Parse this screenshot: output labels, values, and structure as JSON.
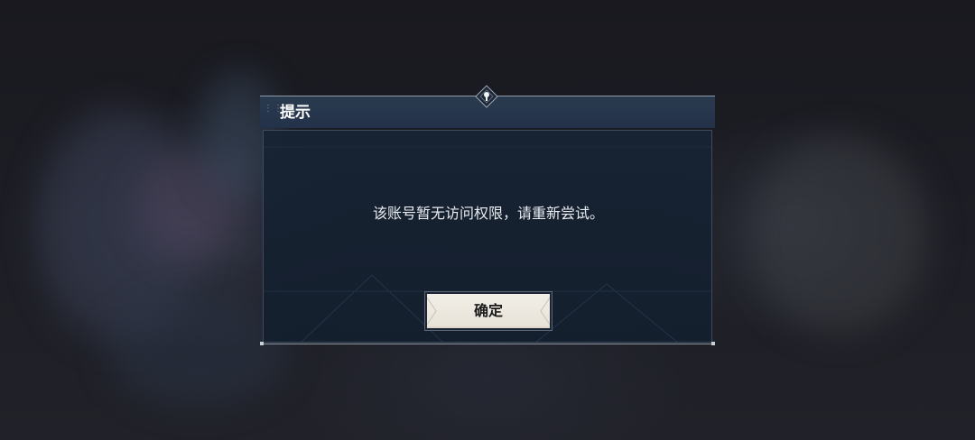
{
  "dialog": {
    "title": "提示",
    "message": "该账号暂无访问权限，请重新尝试。",
    "confirm_label": "确定",
    "grip_glyph": "⋮⋮",
    "ornament_icon": "diamond-emblem-icon"
  },
  "colors": {
    "background": "#1c1d24",
    "title_bar": "#23324a",
    "panel": "#172333",
    "message_text": "#e8ecf1",
    "button_face": "#ece8df",
    "button_text": "#1a1a1a"
  }
}
